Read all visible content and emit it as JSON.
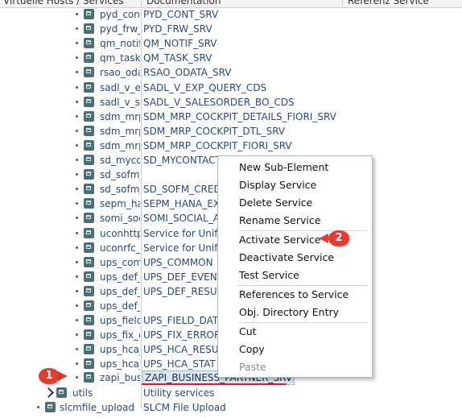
{
  "header": {
    "col1": "Virtuelle Hosts / Services",
    "col2": "Documentation",
    "col3": "Referenz Service"
  },
  "rows": [
    {
      "name": "pyd_cont",
      "doc": "PYD_CONT_SRV"
    },
    {
      "name": "pyd_frw_",
      "doc": "PYD_FRW_SRV"
    },
    {
      "name": "qm_notif",
      "doc": "QM_NOTIF_SRV"
    },
    {
      "name": "qm_task_",
      "doc": "QM_TASK_SRV"
    },
    {
      "name": "rsao_odat",
      "doc": "RSAO_ODATA_SRV"
    },
    {
      "name": "sadl_v_ex",
      "doc": "SADL_V_EXP_QUERY_CDS"
    },
    {
      "name": "sadl_v_sa",
      "doc": "SADL_V_SALESORDER_BO_CDS"
    },
    {
      "name": "sdm_mrp",
      "doc": "SDM_MRP_COCKPIT_DETAILS_FIORI_SRV"
    },
    {
      "name": "sdm_mrp",
      "doc": "SDM_MRP_COCKPIT_DTL_SRV"
    },
    {
      "name": "sdm_mrp",
      "doc": "SDM_MRP_COCKPIT_FIORI_SRV"
    },
    {
      "name": "sd_mycor",
      "doc": "SD_MYCONTACT"
    },
    {
      "name": "sd_sofm_",
      "doc": ""
    },
    {
      "name": "sd_sofm_",
      "doc": "SD_SOFM_CREDI"
    },
    {
      "name": "sepm_ha",
      "doc": "SEPM_HANA_EX"
    },
    {
      "name": "somi_soc",
      "doc": "SOMI_SOCIAL_A"
    },
    {
      "name": "uconhttp",
      "doc": "Service for Unifie"
    },
    {
      "name": "uconrfc_s",
      "doc": "Service for Unifie"
    },
    {
      "name": "ups_com",
      "doc": "UPS_COMMON"
    },
    {
      "name": "ups_def_",
      "doc": "UPS_DEF_EVENT"
    },
    {
      "name": "ups_def_",
      "doc": "UPS_DEF_RESUL"
    },
    {
      "name": "ups_def_",
      "doc": ""
    },
    {
      "name": "ups_field",
      "doc": "UPS_FIELD_DAT"
    },
    {
      "name": "ups_fix_e",
      "doc": "UPS_FIX_ERROR"
    },
    {
      "name": "ups_hca_",
      "doc": "UPS_HCA_RESUL"
    },
    {
      "name": "ups_hca_",
      "doc": "UPS_HCA_STAT"
    }
  ],
  "selected_row": {
    "name": "zapi_busin",
    "doc": "ZAPI_BUSINESS_PARTNER_SRV"
  },
  "utils_row": {
    "name": "utils",
    "doc": "Utility services"
  },
  "last_row": {
    "name": "slcmfile_upload",
    "doc": "SLCM File Upload"
  },
  "context_menu": {
    "items": [
      "New Sub-Element",
      "Display Service",
      "Delete Service",
      "Rename Service",
      "Activate Service",
      "Deactivate Service",
      "Test Service",
      "References to Service",
      "Obj. Directory Entry",
      "Cut",
      "Copy",
      "Paste"
    ]
  },
  "markers": {
    "one": "1",
    "two": "2"
  },
  "colors": {
    "marker": "#e23b2f",
    "selection": "#dbe8f6",
    "service_icon": "#4d6e75"
  }
}
